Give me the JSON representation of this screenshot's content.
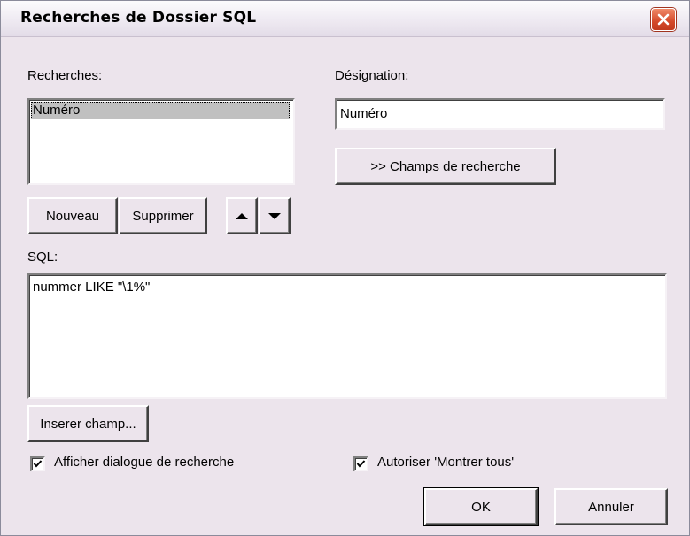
{
  "window": {
    "title": "Recherches de Dossier SQL"
  },
  "searches": {
    "label": "Recherches:",
    "items": [
      "Numéro"
    ],
    "selected_index": 0
  },
  "designation": {
    "label": "Désignation:",
    "value": "Numéro"
  },
  "buttons": {
    "search_fields": ">> Champs de recherche",
    "new": "Nouveau",
    "delete": "Supprimer",
    "insert_field": "Inserer champ...",
    "ok": "OK",
    "cancel": "Annuler"
  },
  "icons": {
    "move_up": "arrow-up-icon",
    "move_down": "arrow-down-icon",
    "close": "close-icon"
  },
  "sql": {
    "label": "SQL:",
    "value": "nummer LIKE \"\\1%\""
  },
  "options": {
    "show_search_dialog": {
      "label": "Afficher dialogue de recherche",
      "checked": true
    },
    "allow_show_all": {
      "label": "Autoriser 'Montrer tous'",
      "checked": true
    }
  },
  "colors": {
    "dialog_bg": "#ece4ec",
    "close_button": "#d4492a",
    "selection": "#c0c0c0"
  }
}
